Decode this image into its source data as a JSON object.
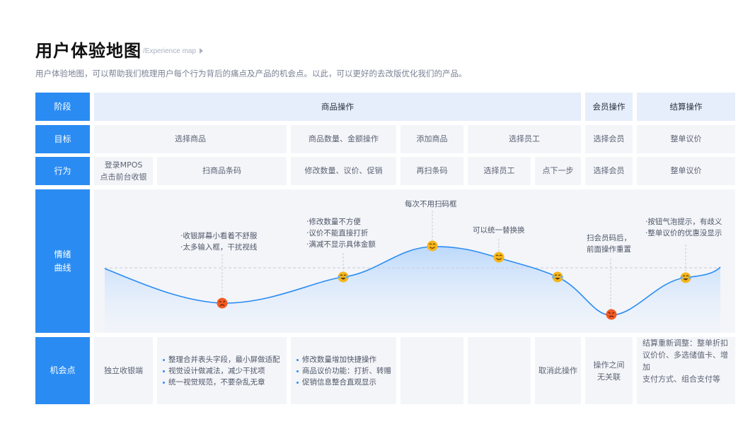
{
  "header": {
    "title": "用户体验地图",
    "subtitle": "/Experience map",
    "description": "用户体验地图，可以帮助我们梳理用户每个行为背后的痛点及产品的机会点。以此，可以更好的去改版优化我们的产品。"
  },
  "row_labels": {
    "stage": "阶段",
    "goal": "目标",
    "action": "行为",
    "emotion_line1": "情绪",
    "emotion_line2": "曲线",
    "opportunity": "机会点"
  },
  "stages": [
    "商品操作",
    "会员操作",
    "结算操作"
  ],
  "goals": [
    "选择商品",
    "商品数量、金额操作",
    "添加商品",
    "选择员工",
    "选择会员",
    "整单议价"
  ],
  "actions": [
    {
      "line1": "登录MPOS",
      "line2": "点击前台收银"
    },
    {
      "line1": "扫商品条码"
    },
    {
      "line1": "修改数量、议价、促销"
    },
    {
      "line1": "再扫条码"
    },
    {
      "line1": "选择员工"
    },
    {
      "line1": "点下一步"
    },
    {
      "line1": "选择会员"
    },
    {
      "line1": "整单议价"
    }
  ],
  "emotion": {
    "colors": {
      "line": "#2a8cf2",
      "fill_top": "#b9d7fb",
      "angry": "#f05a24",
      "happy": "#f7b51c"
    },
    "notes": {
      "n1": [
        "收银屏幕小看着不舒服",
        "太多输入框，干扰视线"
      ],
      "n2": [
        "修改数量不方便",
        "议价不能直接打折",
        "满减不显示具体金额"
      ],
      "n3": [
        "每次不用扫码框"
      ],
      "n4": [
        "可以统一替换换"
      ],
      "n5": [
        "扫会员码后，",
        "前面操作重置"
      ],
      "n6": [
        "按钮气泡提示，有歧义",
        "整单议价的优惠没显示"
      ]
    },
    "points": [
      {
        "name": "angry",
        "icon": "angry-face-icon"
      },
      {
        "name": "neutral",
        "icon": "crying-laughing-face-icon"
      },
      {
        "name": "happy",
        "icon": "smiling-face-icon"
      },
      {
        "name": "happy",
        "icon": "smiling-face-icon"
      },
      {
        "name": "neutral",
        "icon": "crying-laughing-face-icon"
      },
      {
        "name": "angry",
        "icon": "angry-face-icon"
      },
      {
        "name": "neutral",
        "icon": "crying-laughing-face-icon"
      }
    ]
  },
  "opportunities": {
    "c1": "独立收银端",
    "c2": [
      "整理合并表头字段，最小屏做适配",
      "视觉设计做减法，减少干扰项",
      "统一视觉规范，不要杂乱无章"
    ],
    "c3": [
      "修改数量增加快捷操作",
      "商品议价功能：打折、转赠",
      "促销信息整合直观显示"
    ],
    "c6": "取消此操作",
    "c7": [
      "操作之间",
      "无关联"
    ],
    "c8": [
      "结算重新调整：整单折扣",
      "议价价、多选储值卡、增加",
      "支付方式、组合支付等"
    ]
  }
}
